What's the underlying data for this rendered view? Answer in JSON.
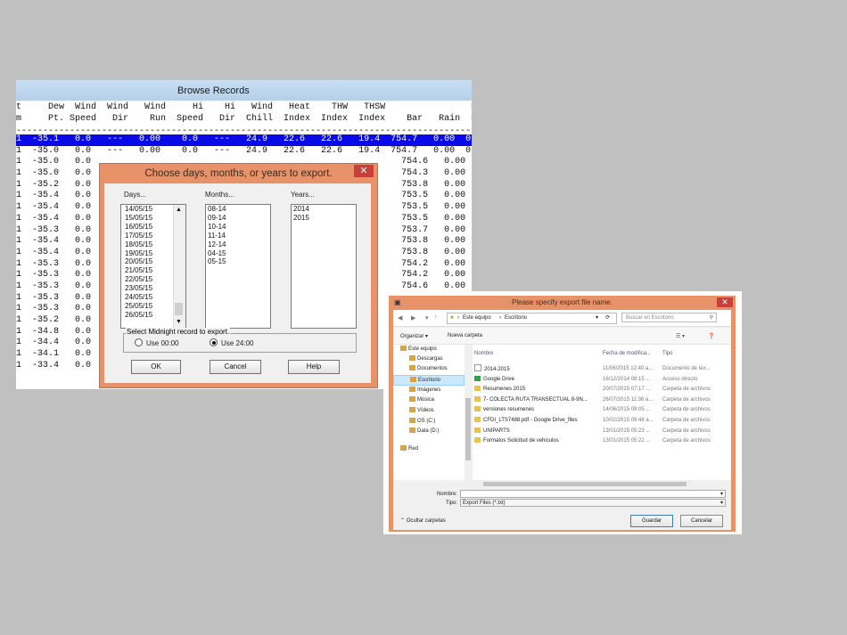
{
  "browse": {
    "title": "Browse Records",
    "header_line1": "t     Dew  Wind  Wind   Wind     Hi    Hi   Wind   Heat    THW   THSW                Ra",
    "header_line2": "m     Pt. Speed   Dir    Run  Speed   Dir  Chill  Index  Index  Index    Bar   Rain  Ra",
    "separator": "----------------------------------------------------------------------------------------",
    "rows": [
      "1  -35.1   0.0   ---   0.00    0.0   ---   24.9   22.6   22.6   19.4  754.7   0.00  0.",
      "1  -35.0   0.0   ---   0.00    0.0   ---   24.9   22.6   22.6   19.4  754.7   0.00  0.",
      "1  -35.0   0.0                                                          754.6   0.00  0.",
      "1  -35.0   0.0                                                          754.3   0.00  0.",
      "1  -35.2   0.0                                                          753.8   0.00  0.",
      "1  -35.4   0.0                                                          753.5   0.00  0.",
      "1  -35.4   0.0                                                          753.5   0.00  0.",
      "1  -35.4   0.0                                                          753.5   0.00  0.",
      "1  -35.3   0.0                                                          753.7   0.00  0.",
      "1  -35.4   0.0                                                          753.8   0.00  0.",
      "1  -35.4   0.0                                                          753.8   0.00  0.",
      "1  -35.3   0.0                                                          754.2   0.00  0.",
      "1  -35.3   0.0                                                          754.2   0.00  0.",
      "1  -35.3   0.0                                                          754.6   0.00  0.",
      "1  -35.3   0.0",
      "1  -35.3   0.0",
      "1  -35.2   0.0",
      "1  -34.8   0.0",
      "1  -34.4   0.0",
      "1  -34.1   0.0",
      "1  -33.4   0.0"
    ],
    "selected_row": 0
  },
  "choose_dialog": {
    "title": "Choose days, months, or years to export.",
    "close": "✕",
    "days_label": "Days...",
    "months_label": "Months...",
    "years_label": "Years...",
    "days": [
      "14/05/15",
      "15/05/15",
      "16/05/15",
      "17/05/15",
      "18/05/15",
      "19/05/15",
      "20/05/15",
      "21/05/15",
      "22/05/15",
      "23/05/15",
      "24/05/15",
      "25/05/15",
      "26/05/15"
    ],
    "months": [
      "08-14",
      "09-14",
      "10-14",
      "11-14",
      "12-14",
      "04-15",
      "05-15"
    ],
    "years": [
      "2014",
      "2015"
    ],
    "midnight_label": "Select Midnight record to export.",
    "use_0000": "Use 00:00",
    "use_2400": "Use 24:00",
    "selected_midnight": "24:00",
    "ok": "OK",
    "cancel": "Cancel",
    "help": "Help"
  },
  "export_dialog": {
    "title": "Please specify export file name.",
    "close": "✕",
    "path": [
      "Este equipo",
      "Escritorio"
    ],
    "search_placeholder": "Buscar en Escritorio",
    "organize": "Organizar ▾",
    "new_folder": "Nueva carpeta",
    "tree": [
      {
        "label": "Este equipo",
        "indent": 0
      },
      {
        "label": "Descargas",
        "indent": 1
      },
      {
        "label": "Documentos",
        "indent": 1
      },
      {
        "label": "Escritorio",
        "indent": 1,
        "selected": true
      },
      {
        "label": "Imágenes",
        "indent": 1
      },
      {
        "label": "Música",
        "indent": 1
      },
      {
        "label": "Vídeos",
        "indent": 1
      },
      {
        "label": "OS (C:)",
        "indent": 1
      },
      {
        "label": "Data (D:)",
        "indent": 1
      },
      {
        "label": "Red",
        "indent": 0
      }
    ],
    "columns": {
      "name": "Nombre",
      "date": "Fecha de modifica...",
      "type": "Tipo"
    },
    "files": [
      {
        "name": "2014-2015",
        "date": "11/06/2015 12:40 a...",
        "type": "Documento de tex...",
        "icon": "doc"
      },
      {
        "name": "Google Drive",
        "date": "16/12/2014 08:15 ...",
        "type": "Acceso directo",
        "icon": "drive"
      },
      {
        "name": "Resumenes 2015",
        "date": "20/07/2015 07:17 ...",
        "type": "Carpeta de archivos",
        "icon": "folder"
      },
      {
        "name": "7- COLECTA RUTA TRANSECTUAL  8-9N...",
        "date": "26/07/2015 11:36 a...",
        "type": "Carpeta de archivos",
        "icon": "folder"
      },
      {
        "name": "versiones resumenes",
        "date": "14/06/2015 09:05 ...",
        "type": "Carpeta de archivos",
        "icon": "folder"
      },
      {
        "name": "CFDI_LTS7488.pdf - Google Drive_files",
        "date": "10/02/2015 09:48 a...",
        "type": "Carpeta de archivos",
        "icon": "folder"
      },
      {
        "name": "UNIPARTS",
        "date": "13/01/2015 05:23 ...",
        "type": "Carpeta de archivos",
        "icon": "folder"
      },
      {
        "name": "Formatos Solicitud de vehiculos",
        "date": "13/01/2015 05:22 ...",
        "type": "Carpeta de archivos",
        "icon": "folder"
      }
    ],
    "filename_label": "Nombre:",
    "filename_value": "",
    "filetype_label": "Tipo:",
    "filetype_value": "Export Files (*.txt)",
    "hide_folders": "Ocultar carpetas",
    "save": "Guardar",
    "cancel": "Cancelar"
  }
}
